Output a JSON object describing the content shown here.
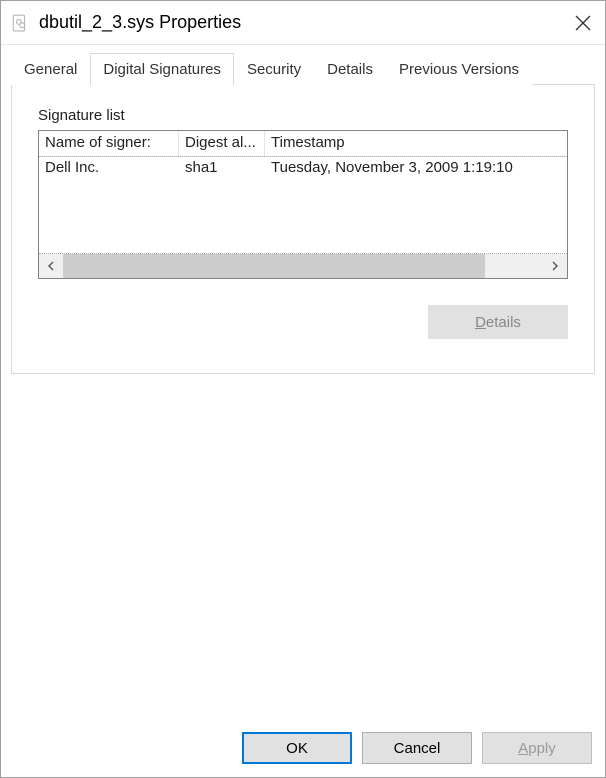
{
  "window": {
    "title": "dbutil_2_3.sys Properties"
  },
  "tabs": {
    "general": "General",
    "digital_signatures": "Digital Signatures",
    "security": "Security",
    "details": "Details",
    "previous_versions": "Previous Versions"
  },
  "panel": {
    "fieldset_label": "Signature list",
    "columns": {
      "name": "Name of signer:",
      "digest": "Digest al...",
      "timestamp": "Timestamp"
    },
    "rows": [
      {
        "name": "Dell Inc.",
        "digest": "sha1",
        "timestamp": "Tuesday, November 3, 2009 1:19:10 "
      }
    ],
    "details_button": {
      "pre": "",
      "u": "D",
      "post": "etails"
    }
  },
  "buttons": {
    "ok": "OK",
    "cancel": "Cancel",
    "apply": {
      "u": "A",
      "post": "pply"
    }
  }
}
